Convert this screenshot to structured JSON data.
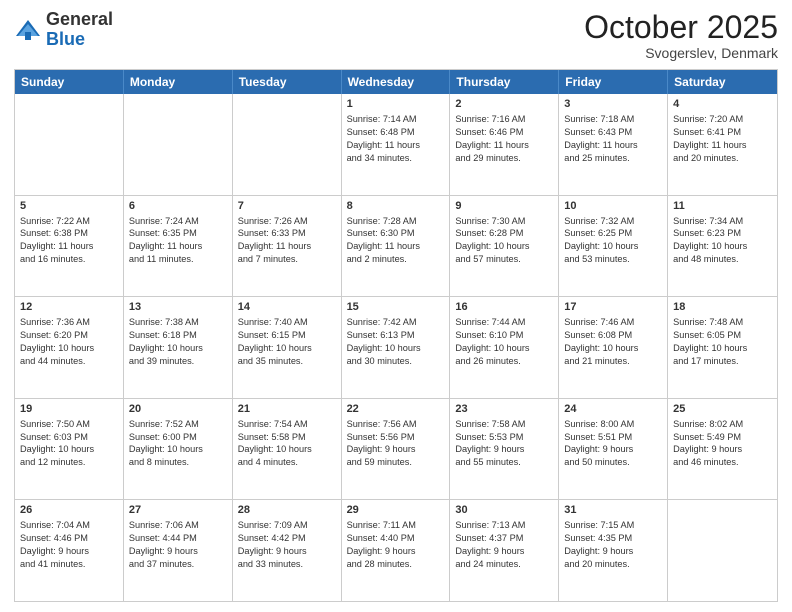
{
  "header": {
    "logo_general": "General",
    "logo_blue": "Blue",
    "month_year": "October 2025",
    "location": "Svogerslev, Denmark"
  },
  "days_of_week": [
    "Sunday",
    "Monday",
    "Tuesday",
    "Wednesday",
    "Thursday",
    "Friday",
    "Saturday"
  ],
  "weeks": [
    [
      {
        "day": "",
        "info": ""
      },
      {
        "day": "",
        "info": ""
      },
      {
        "day": "",
        "info": ""
      },
      {
        "day": "1",
        "info": "Sunrise: 7:14 AM\nSunset: 6:48 PM\nDaylight: 11 hours\nand 34 minutes."
      },
      {
        "day": "2",
        "info": "Sunrise: 7:16 AM\nSunset: 6:46 PM\nDaylight: 11 hours\nand 29 minutes."
      },
      {
        "day": "3",
        "info": "Sunrise: 7:18 AM\nSunset: 6:43 PM\nDaylight: 11 hours\nand 25 minutes."
      },
      {
        "day": "4",
        "info": "Sunrise: 7:20 AM\nSunset: 6:41 PM\nDaylight: 11 hours\nand 20 minutes."
      }
    ],
    [
      {
        "day": "5",
        "info": "Sunrise: 7:22 AM\nSunset: 6:38 PM\nDaylight: 11 hours\nand 16 minutes."
      },
      {
        "day": "6",
        "info": "Sunrise: 7:24 AM\nSunset: 6:35 PM\nDaylight: 11 hours\nand 11 minutes."
      },
      {
        "day": "7",
        "info": "Sunrise: 7:26 AM\nSunset: 6:33 PM\nDaylight: 11 hours\nand 7 minutes."
      },
      {
        "day": "8",
        "info": "Sunrise: 7:28 AM\nSunset: 6:30 PM\nDaylight: 11 hours\nand 2 minutes."
      },
      {
        "day": "9",
        "info": "Sunrise: 7:30 AM\nSunset: 6:28 PM\nDaylight: 10 hours\nand 57 minutes."
      },
      {
        "day": "10",
        "info": "Sunrise: 7:32 AM\nSunset: 6:25 PM\nDaylight: 10 hours\nand 53 minutes."
      },
      {
        "day": "11",
        "info": "Sunrise: 7:34 AM\nSunset: 6:23 PM\nDaylight: 10 hours\nand 48 minutes."
      }
    ],
    [
      {
        "day": "12",
        "info": "Sunrise: 7:36 AM\nSunset: 6:20 PM\nDaylight: 10 hours\nand 44 minutes."
      },
      {
        "day": "13",
        "info": "Sunrise: 7:38 AM\nSunset: 6:18 PM\nDaylight: 10 hours\nand 39 minutes."
      },
      {
        "day": "14",
        "info": "Sunrise: 7:40 AM\nSunset: 6:15 PM\nDaylight: 10 hours\nand 35 minutes."
      },
      {
        "day": "15",
        "info": "Sunrise: 7:42 AM\nSunset: 6:13 PM\nDaylight: 10 hours\nand 30 minutes."
      },
      {
        "day": "16",
        "info": "Sunrise: 7:44 AM\nSunset: 6:10 PM\nDaylight: 10 hours\nand 26 minutes."
      },
      {
        "day": "17",
        "info": "Sunrise: 7:46 AM\nSunset: 6:08 PM\nDaylight: 10 hours\nand 21 minutes."
      },
      {
        "day": "18",
        "info": "Sunrise: 7:48 AM\nSunset: 6:05 PM\nDaylight: 10 hours\nand 17 minutes."
      }
    ],
    [
      {
        "day": "19",
        "info": "Sunrise: 7:50 AM\nSunset: 6:03 PM\nDaylight: 10 hours\nand 12 minutes."
      },
      {
        "day": "20",
        "info": "Sunrise: 7:52 AM\nSunset: 6:00 PM\nDaylight: 10 hours\nand 8 minutes."
      },
      {
        "day": "21",
        "info": "Sunrise: 7:54 AM\nSunset: 5:58 PM\nDaylight: 10 hours\nand 4 minutes."
      },
      {
        "day": "22",
        "info": "Sunrise: 7:56 AM\nSunset: 5:56 PM\nDaylight: 9 hours\nand 59 minutes."
      },
      {
        "day": "23",
        "info": "Sunrise: 7:58 AM\nSunset: 5:53 PM\nDaylight: 9 hours\nand 55 minutes."
      },
      {
        "day": "24",
        "info": "Sunrise: 8:00 AM\nSunset: 5:51 PM\nDaylight: 9 hours\nand 50 minutes."
      },
      {
        "day": "25",
        "info": "Sunrise: 8:02 AM\nSunset: 5:49 PM\nDaylight: 9 hours\nand 46 minutes."
      }
    ],
    [
      {
        "day": "26",
        "info": "Sunrise: 7:04 AM\nSunset: 4:46 PM\nDaylight: 9 hours\nand 41 minutes."
      },
      {
        "day": "27",
        "info": "Sunrise: 7:06 AM\nSunset: 4:44 PM\nDaylight: 9 hours\nand 37 minutes."
      },
      {
        "day": "28",
        "info": "Sunrise: 7:09 AM\nSunset: 4:42 PM\nDaylight: 9 hours\nand 33 minutes."
      },
      {
        "day": "29",
        "info": "Sunrise: 7:11 AM\nSunset: 4:40 PM\nDaylight: 9 hours\nand 28 minutes."
      },
      {
        "day": "30",
        "info": "Sunrise: 7:13 AM\nSunset: 4:37 PM\nDaylight: 9 hours\nand 24 minutes."
      },
      {
        "day": "31",
        "info": "Sunrise: 7:15 AM\nSunset: 4:35 PM\nDaylight: 9 hours\nand 20 minutes."
      },
      {
        "day": "",
        "info": ""
      }
    ]
  ]
}
